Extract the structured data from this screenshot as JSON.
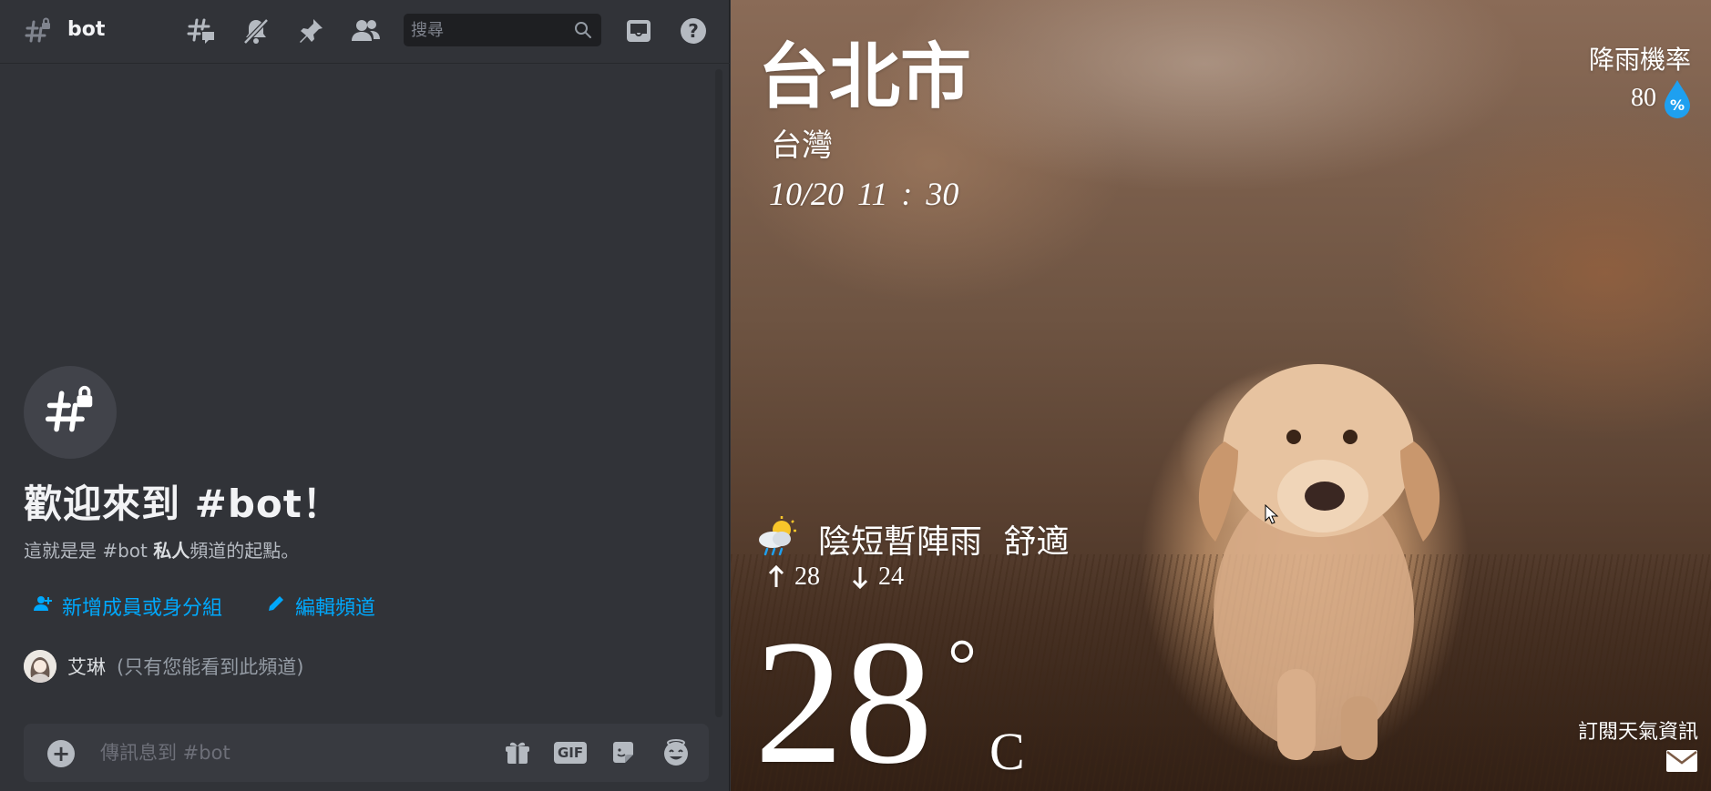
{
  "discord": {
    "channel": {
      "name": "bot",
      "icon": "hashtag-lock-icon"
    },
    "header_icons": [
      "threads-icon",
      "bell-muted-icon",
      "pin-icon",
      "members-icon",
      "inbox-icon",
      "help-icon"
    ],
    "search": {
      "placeholder": "搜尋"
    },
    "welcome": {
      "title": "歡迎來到 #bot！",
      "subtitle_prefix": "這就是是 #bot ",
      "subtitle_bold": "私人",
      "subtitle_suffix": "頻道的起點。"
    },
    "actions": {
      "add_member": "新增成員或身分組",
      "edit_channel": "編輯頻道"
    },
    "owner": {
      "name": "艾琳",
      "note": "(只有您能看到此頻道)"
    },
    "composer": {
      "placeholder": "傳訊息到 #bot",
      "gif_label": "GIF"
    },
    "colors": {
      "background": "#313338",
      "link": "#00a8fc",
      "input": "#383a40"
    }
  },
  "weather": {
    "city": "台北市",
    "country": "台灣",
    "datetime": "10/20  11 : 30",
    "rain_label": "降雨機率",
    "rain_value": "80",
    "rain_unit": "%",
    "condition": "陰短暫陣雨  舒適",
    "high": "28",
    "low": "24",
    "temperature": "28",
    "degree": "°",
    "unit": "C",
    "subscribe": "訂閱天氣資訊",
    "icons": [
      "cloud-sun-rain-icon",
      "arrow-up-icon",
      "arrow-down-icon",
      "water-drop-icon",
      "mail-icon"
    ]
  }
}
